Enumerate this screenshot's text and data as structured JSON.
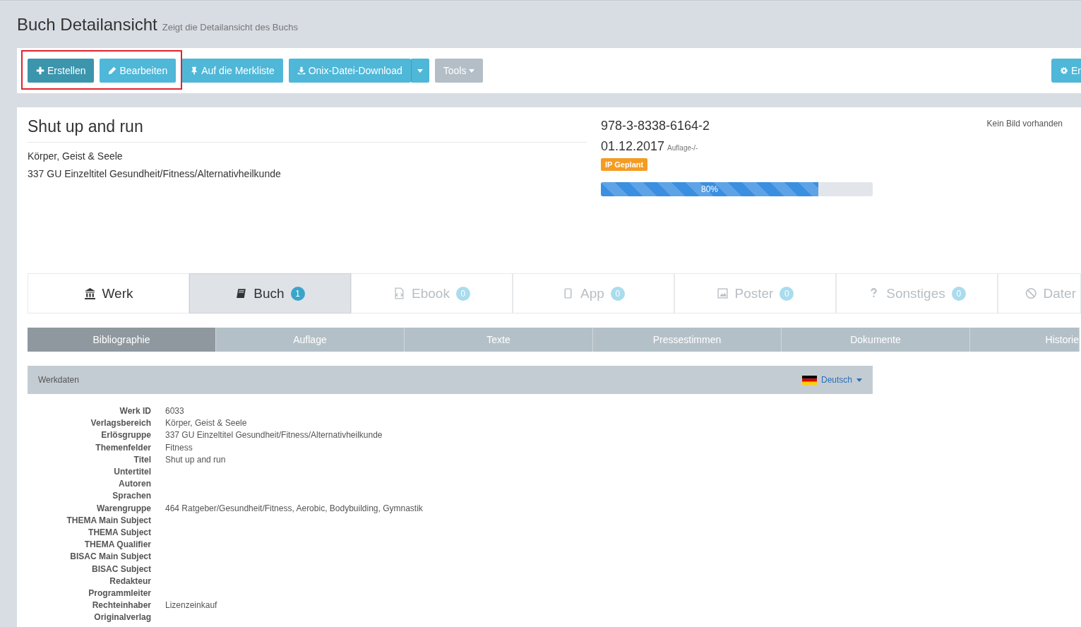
{
  "page_header": {
    "title": "Buch Detailansicht",
    "subtitle": "Zeigt die Detailansicht des Buchs"
  },
  "toolbar": {
    "buttons": [
      {
        "kind": "dark",
        "label": "Erstellen"
      },
      {
        "kind": "info",
        "label": "Bearbeiten"
      },
      {
        "kind": "info",
        "label": "Auf die Merkliste"
      },
      {
        "kind": "split",
        "label": "Onix-Datei-Download"
      },
      {
        "kind": "muted",
        "label": "Tools"
      }
    ],
    "right_button": {
      "label": "Er"
    }
  },
  "book": {
    "title": "Shut up and run",
    "lines": [
      "Körper, Geist & Seele",
      "337 GU Einzeltitel Gesundheit/Fitness/Alternativheilkunde"
    ],
    "isbn": "978-3-8338-6164-2",
    "date": "01.12.2017",
    "edition": "Auflage-/-",
    "status_badge": "IP Geplant",
    "progress": {
      "level": 0.8,
      "label": "80%"
    },
    "image_note": "Kein Bild vorhanden"
  },
  "type_tabs": [
    {
      "label": "Werk",
      "selected": false,
      "disabled": false
    },
    {
      "label": "Buch",
      "count": "1",
      "selected": true,
      "disabled": false
    },
    {
      "label": "Ebook",
      "count": "0",
      "selected": false,
      "disabled": true
    },
    {
      "label": "App",
      "count": "0",
      "selected": false,
      "disabled": true
    },
    {
      "label": "Poster",
      "count": "0",
      "selected": false,
      "disabled": true
    },
    {
      "label": "Sonstiges",
      "count": "0",
      "selected": false,
      "disabled": true
    },
    {
      "label": "Dater",
      "selected": false,
      "disabled": true
    }
  ],
  "section_tabs": [
    {
      "label": "Bibliographie",
      "selected": true
    },
    {
      "label": "Auflage",
      "selected": false
    },
    {
      "label": "Texte",
      "selected": false
    },
    {
      "label": "Pressestimmen",
      "selected": false
    },
    {
      "label": "Dokumente",
      "selected": false
    },
    {
      "label": "Historie",
      "selected": false
    }
  ],
  "panel": {
    "title": "Werkdaten",
    "language": "Deutsch"
  },
  "fields": [
    {
      "label": "Werk ID",
      "value": "6033"
    },
    {
      "label": "Verlagsbereich",
      "value": "Körper, Geist & Seele"
    },
    {
      "label": "Erlösgruppe",
      "value": "337 GU Einzeltitel Gesundheit/Fitness/Alternativheilkunde"
    },
    {
      "label": "Themenfelder",
      "value": "Fitness"
    },
    {
      "label": "Titel",
      "value": "Shut up and run"
    },
    {
      "label": "Untertitel"
    },
    {
      "label": "Autoren"
    },
    {
      "label": "Sprachen"
    },
    {
      "label": "Warengruppe",
      "value": "464 Ratgeber/Gesundheit/Fitness, Aerobic, Bodybuilding, Gymnastik"
    },
    {
      "label": "THEMA Main Subject"
    },
    {
      "label": "THEMA Subject"
    },
    {
      "label": "THEMA Qualifier"
    },
    {
      "label": "BISAC Main Subject"
    },
    {
      "label": "BISAC Subject"
    },
    {
      "label": "Redakteur"
    },
    {
      "label": "Programmleiter"
    },
    {
      "label": "Rechteinhaber",
      "value": "Lizenzeinkauf"
    },
    {
      "label": "Originalverlag"
    }
  ]
}
